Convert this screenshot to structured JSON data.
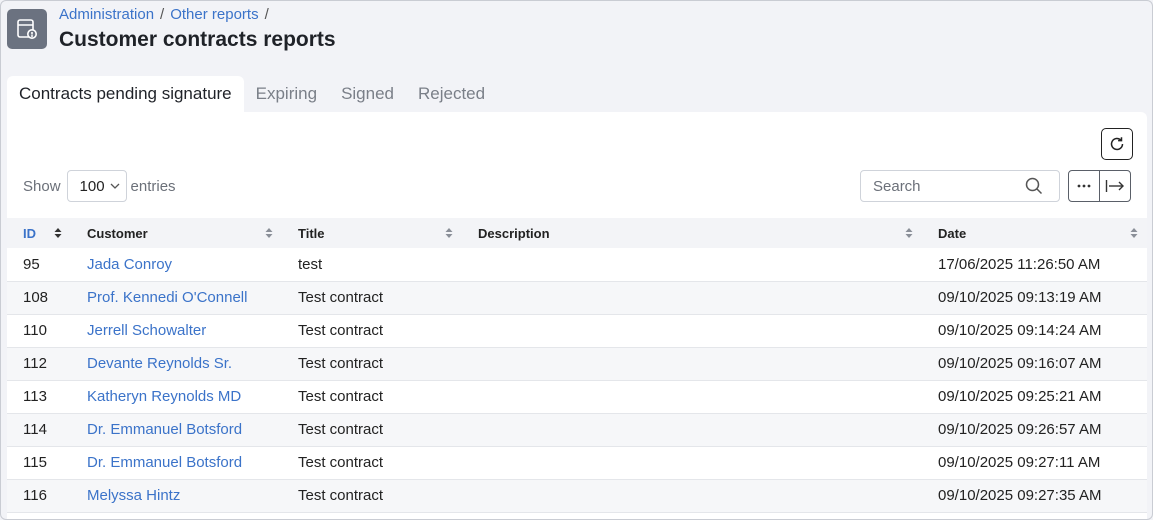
{
  "breadcrumb": {
    "item1": "Administration",
    "item2": "Other reports",
    "sep": "/"
  },
  "page_title": "Customer contracts reports",
  "tabs": [
    {
      "label": "Contracts pending signature",
      "active": true
    },
    {
      "label": "Expiring"
    },
    {
      "label": "Signed"
    },
    {
      "label": "Rejected"
    }
  ],
  "controls": {
    "show_label": "Show",
    "entries_value": "100",
    "entries_label": "entries",
    "search_placeholder": "Search"
  },
  "table": {
    "columns": [
      "ID",
      "Customer",
      "Title",
      "Description",
      "Date"
    ],
    "rows": [
      {
        "id": "95",
        "customer": "Jada Conroy",
        "title": "test",
        "description": "",
        "date": "17/06/2025 11:26:50 AM"
      },
      {
        "id": "108",
        "customer": "Prof. Kennedi O'Connell",
        "title": "Test contract",
        "description": "",
        "date": "09/10/2025 09:13:19 AM"
      },
      {
        "id": "110",
        "customer": "Jerrell Schowalter",
        "title": "Test contract",
        "description": "",
        "date": "09/10/2025 09:14:24 AM"
      },
      {
        "id": "112",
        "customer": "Devante Reynolds Sr.",
        "title": "Test contract",
        "description": "",
        "date": "09/10/2025 09:16:07 AM"
      },
      {
        "id": "113",
        "customer": "Katheryn Reynolds MD",
        "title": "Test contract",
        "description": "",
        "date": "09/10/2025 09:25:21 AM"
      },
      {
        "id": "114",
        "customer": "Dr. Emmanuel Botsford",
        "title": "Test contract",
        "description": "",
        "date": "09/10/2025 09:26:57 AM"
      },
      {
        "id": "115",
        "customer": "Dr. Emmanuel Botsford",
        "title": "Test contract",
        "description": "",
        "date": "09/10/2025 09:27:11 AM"
      },
      {
        "id": "116",
        "customer": "Melyssa Hintz",
        "title": "Test contract",
        "description": "",
        "date": "09/10/2025 09:27:35 AM"
      }
    ]
  },
  "colors": {
    "link": "#3b73c9",
    "icon_bg": "#6b7280",
    "page_bg": "#f2f3f7"
  },
  "icons": [
    "report-icon",
    "refresh-icon",
    "chevron-down-icon",
    "search-icon",
    "more-icon",
    "export-icon",
    "sort-icon"
  ]
}
